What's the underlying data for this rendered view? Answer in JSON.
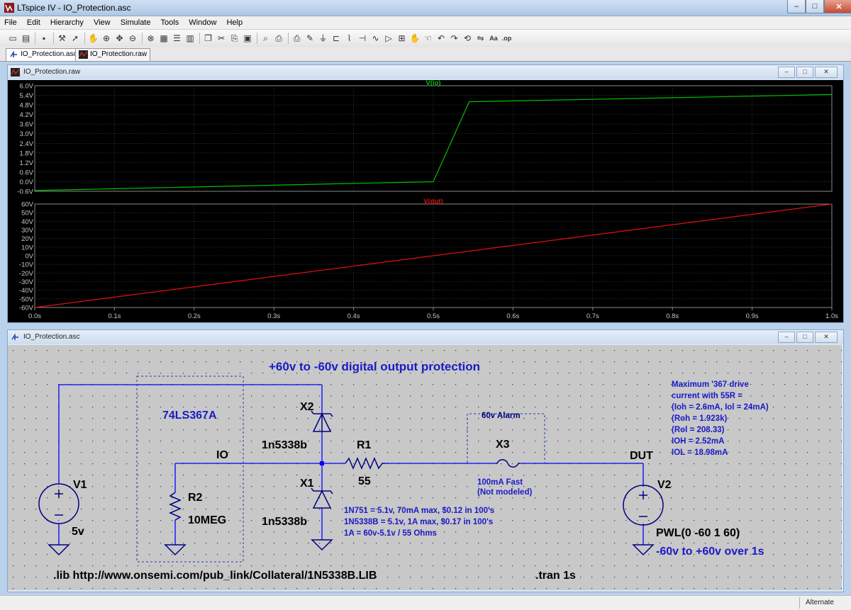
{
  "app": {
    "title": "LTspice IV - IO_Protection.asc"
  },
  "window_controls": {
    "minimize": "–",
    "maximize": "□",
    "close": "✕"
  },
  "menu": [
    "File",
    "Edit",
    "Hierarchy",
    "View",
    "Simulate",
    "Tools",
    "Window",
    "Help"
  ],
  "toolbar_icons": [
    "new-schematic-icon",
    "open-icon",
    "save-icon",
    "control-panel-icon",
    "run-icon",
    "halt-icon",
    "zoom-in-icon",
    "pan-icon",
    "zoom-out-icon",
    "zoom-fit-icon",
    "autorange-icon",
    "tile-horizontal-icon",
    "tile-vertical-icon",
    "cascade-icon",
    "cut-icon",
    "copy-icon",
    "paste-icon",
    "find-icon",
    "print-preview-icon",
    "print-icon",
    "draw-wire-icon",
    "ground-icon",
    "label-net-icon",
    "resistor-icon",
    "capacitor-icon",
    "inductor-icon",
    "diode-icon",
    "component-icon",
    "move-icon",
    "drag-icon",
    "undo-icon",
    "redo-icon",
    "rotate-icon",
    "mirror-icon",
    "text-icon",
    "spice-directive-icon"
  ],
  "tabs": [
    {
      "label": "IO_Protection.asc",
      "icon": "schematic-icon",
      "active": true
    },
    {
      "label": "IO_Protection.raw",
      "icon": "waveform-icon",
      "active": false
    }
  ],
  "waveform_window": {
    "title": "IO_Protection.raw",
    "bg_color": "#000000",
    "grid_color": "#555555",
    "tick_label_color": "#c8c8c8"
  },
  "chart_data": [
    {
      "type": "line",
      "series": [
        {
          "name": "V(io)",
          "color": "#00c000",
          "x": [
            0.0,
            0.1,
            0.2,
            0.3,
            0.4,
            0.5,
            0.545,
            0.6,
            0.7,
            0.8,
            0.9,
            1.0
          ],
          "y": [
            -0.55,
            -0.44,
            -0.33,
            -0.22,
            -0.11,
            0.0,
            5.0,
            5.05,
            5.15,
            5.25,
            5.35,
            5.45
          ]
        }
      ],
      "y_ticks": [
        "6.0V",
        "5.4V",
        "4.8V",
        "4.2V",
        "3.6V",
        "3.0V",
        "2.4V",
        "1.8V",
        "1.2V",
        "0.6V",
        "0.0V",
        "-0.6V"
      ],
      "ylim": [
        -0.6,
        6.0
      ],
      "xlim": [
        0.0,
        1.0
      ],
      "grid": true
    },
    {
      "type": "line",
      "series": [
        {
          "name": "V(dut)",
          "color": "#e01010",
          "x": [
            0.0,
            1.0
          ],
          "y": [
            -60,
            60
          ]
        }
      ],
      "y_ticks": [
        "60V",
        "50V",
        "40V",
        "30V",
        "20V",
        "10V",
        "0V",
        "-10V",
        "-20V",
        "-30V",
        "-40V",
        "-50V",
        "-60V"
      ],
      "ylim": [
        -60,
        60
      ],
      "xlim": [
        0.0,
        1.0
      ],
      "x_ticks": [
        "0.0s",
        "0.1s",
        "0.2s",
        "0.3s",
        "0.4s",
        "0.5s",
        "0.6s",
        "0.7s",
        "0.8s",
        "0.9s",
        "1.0s"
      ],
      "grid": true
    }
  ],
  "schematic_window": {
    "title": "IO_Protection.asc",
    "bg_color": "#c8c8c8",
    "wire_color": "#0000ff",
    "component_color": "#000080",
    "label_color": "#000000",
    "comment_color": "#0000c8"
  },
  "schematic": {
    "title_comment": "+60v to -60v digital output protection",
    "ic_label": "74LS367A",
    "net_io": "IO",
    "net_dut": "DUT",
    "x2_ref": "X2",
    "x2_value": "1n5338b",
    "x1_ref": "X1",
    "x1_value": "1n5338b",
    "r1_ref": "R1",
    "r1_value": "55",
    "r2_ref": "R2",
    "r2_value": "10MEG",
    "v1_ref": "V1",
    "v1_value": "5v",
    "v2_ref": "V2",
    "v2_value": "PWL(0 -60 1 60)",
    "v2_comment": "-60v to +60v over 1s",
    "x3_ref": "X3",
    "alarm_label": "60v Alarm",
    "fuse_line1": "100mA Fast",
    "fuse_line2": "(Not modeled)",
    "notes": [
      "1N751 = 5.1v, 70mA max, $0.12 in 100's",
      "1N5338B = 5.1v, 1A max, $0.17 in 100's",
      "1A = 60v-5.1v / 55 Ohms"
    ],
    "drive_notes": [
      "Maximum '367 drive",
      "current with 55R =",
      "(Ioh = 2.6mA, Iol = 24mA)",
      "(Roh = 1.923k)",
      "(Rol = 208.33)",
      "IOH = 2.52mA",
      "IOL =  18.98mA"
    ],
    "lib_directive": ".lib http://www.onsemi.com/pub_link/Collateral/1N5338B.LIB",
    "tran_directive": ".tran 1s"
  },
  "status": {
    "mode": "Alternate"
  }
}
